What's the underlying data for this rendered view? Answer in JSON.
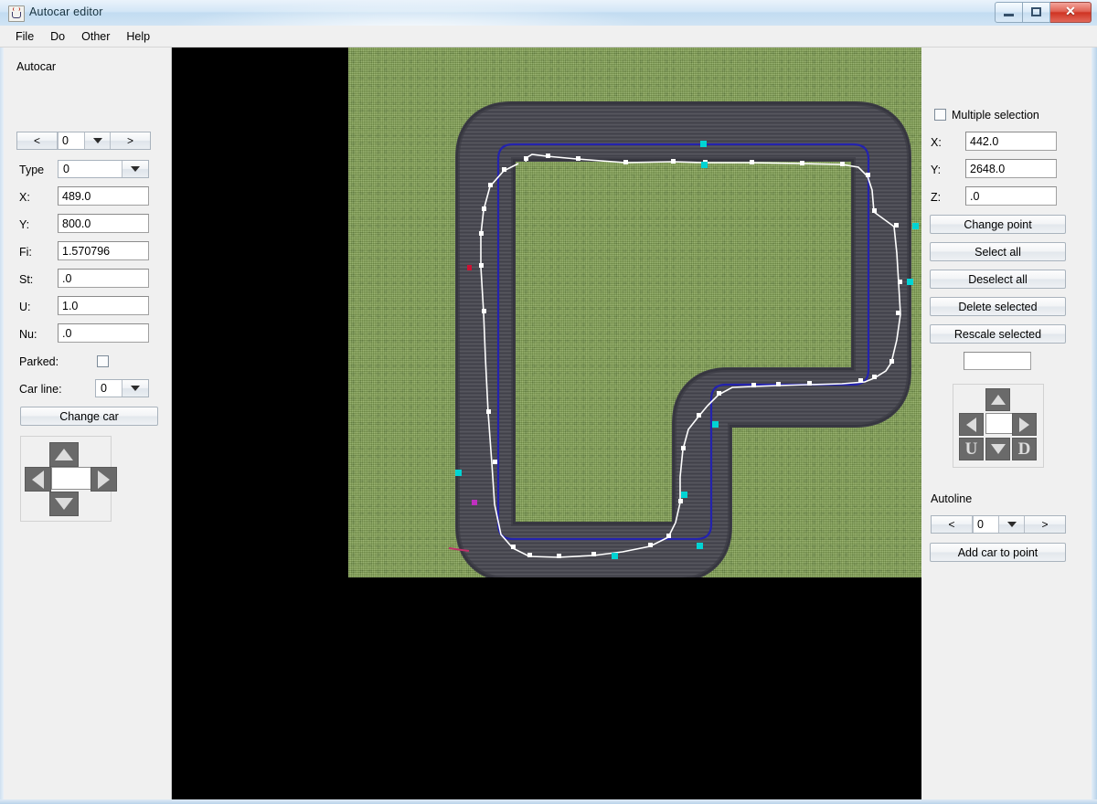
{
  "window": {
    "title": "Autocar editor",
    "app_icon": "java-cup-icon",
    "buttons": {
      "minimize": "minimize-icon",
      "maximize": "maximize-icon",
      "close": "✕"
    }
  },
  "menubar": {
    "items": [
      "File",
      "Do",
      "Other",
      "Help"
    ]
  },
  "left_panel": {
    "title": "Autocar",
    "selector": {
      "prev": "<",
      "value": "0",
      "next": ">"
    },
    "type": {
      "label": "Type",
      "value": "0"
    },
    "fields": [
      {
        "label": "X:",
        "value": "489.0"
      },
      {
        "label": "Y:",
        "value": "800.0"
      },
      {
        "label": "Fi:",
        "value": "1.570796"
      },
      {
        "label": "St:",
        "value": ".0"
      },
      {
        "label": "U:",
        "value": "1.0"
      },
      {
        "label": "Nu:",
        "value": ".0"
      }
    ],
    "parked": {
      "label": "Parked:",
      "checked": false
    },
    "car_line": {
      "label": "Car line:",
      "value": "0"
    },
    "change_car": "Change car",
    "dpad": {
      "up": "▲",
      "left": "◀",
      "right": "▶",
      "down": "▼",
      "center_value": ""
    }
  },
  "right_panel": {
    "multiple_selection": {
      "label": "Multiple selection",
      "checked": false
    },
    "fields": [
      {
        "label": "X:",
        "value": "442.0"
      },
      {
        "label": "Y:",
        "value": "2648.0"
      },
      {
        "label": "Z:",
        "value": ".0"
      }
    ],
    "buttons": [
      "Change point",
      "Select all",
      "Deselect all",
      "Delete selected",
      "Rescale selected"
    ],
    "rescale_value": "",
    "dpad": {
      "up": "▲",
      "left": "◀",
      "right": "▶",
      "down": "▼",
      "up_z": "U",
      "down_z": "D",
      "center_value": ""
    },
    "autoline": {
      "title": "Autoline",
      "selector": {
        "prev": "<",
        "value": "0",
        "next": ">"
      },
      "add_car": "Add car to point"
    }
  },
  "canvas": {
    "background_color": "#000000",
    "grass_color": "#83a354",
    "asphalt_color": "#4a4a52",
    "racing_line_color": "#2020b0",
    "path_line_color": "#ffffff",
    "node_color": "#ffffff",
    "selected_node_color": "#00d8d8",
    "car_marker_color": "#cc1133",
    "magenta_marker_color": "#c030c0"
  }
}
